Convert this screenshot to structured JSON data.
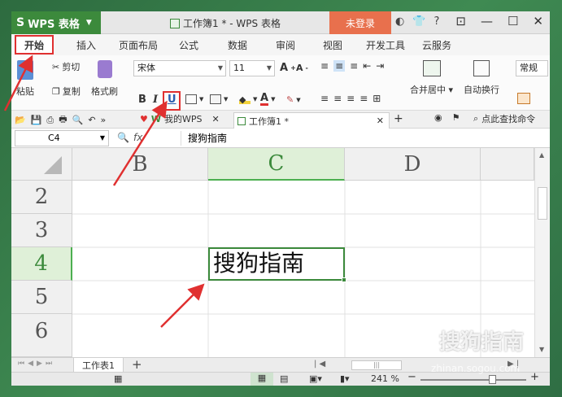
{
  "app": {
    "name": "WPS 表格",
    "doc_title": "工作簿1 * - WPS 表格",
    "login_label": "未登录",
    "help_label": "?"
  },
  "ribbon_tabs": [
    "开始",
    "插入",
    "页面布局",
    "公式",
    "数据",
    "审阅",
    "视图",
    "开发工具",
    "云服务"
  ],
  "ribbon": {
    "paste": "粘贴",
    "cut": "剪切",
    "copy": "复制",
    "format_painter": "格式刷",
    "font_name": "宋体",
    "font_size": "11",
    "bold": "B",
    "italic": "I",
    "underline": "U",
    "merge_center": "合并居中",
    "wrap_text": "自动换行",
    "number_format": "常规"
  },
  "quickbar": {
    "my_wps": "我的WPS",
    "doc_tab": "工作簿1 *",
    "find_command": "点此查找命令"
  },
  "formula_bar": {
    "name_box": "C4",
    "fx": "fx",
    "content": "搜狗指南"
  },
  "grid": {
    "columns": [
      "B",
      "C",
      "D"
    ],
    "rows": [
      "2",
      "3",
      "4",
      "5",
      "6"
    ],
    "active_cell_value": "搜狗指南"
  },
  "sheets": {
    "tabs": [
      "工作表1"
    ],
    "add": "+"
  },
  "statusbar": {
    "zoom": "241 %"
  },
  "watermark": {
    "brand": "搜狗指南",
    "url": "zhinan.sogou.com"
  },
  "colors": {
    "accent_green": "#3c8a3c",
    "login_orange": "#e8704d",
    "annotation_red": "#e03030"
  }
}
